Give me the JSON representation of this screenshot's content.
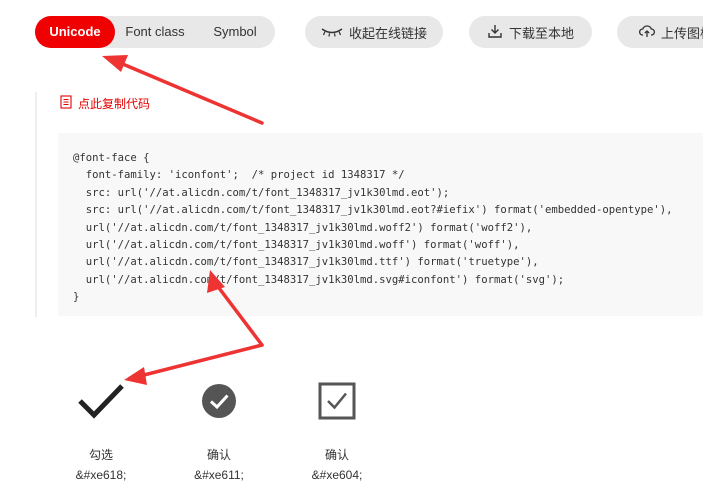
{
  "tabs": [
    "Unicode",
    "Font class",
    "Symbol"
  ],
  "active_tab": "Unicode",
  "toolbar": {
    "collapse_label": "收起在线链接",
    "download_label": "下载至本地",
    "upload_label": "上传图标"
  },
  "copy_link": "点此复制代码",
  "code_lines": [
    "@font-face {",
    "  font-family: 'iconfont';  /* project id 1348317 */",
    "  src: url('//at.alicdn.com/t/font_1348317_jv1k30lmd.eot');",
    "  src: url('//at.alicdn.com/t/font_1348317_jv1k30lmd.eot?#iefix') format('embedded-opentype'),",
    "  url('//at.alicdn.com/t/font_1348317_jv1k30lmd.woff2') format('woff2'),",
    "  url('//at.alicdn.com/t/font_1348317_jv1k30lmd.woff') format('woff'),",
    "  url('//at.alicdn.com/t/font_1348317_jv1k30lmd.ttf') format('truetype'),",
    "  url('//at.alicdn.com/t/font_1348317_jv1k30lmd.svg#iconfont') format('svg');",
    "}"
  ],
  "icons": [
    {
      "name": "勾选",
      "code": "&#xe618;",
      "icon": "checkmark-icon"
    },
    {
      "name": "确认",
      "code": "&#xe611;",
      "icon": "check-circle-icon"
    },
    {
      "name": "确认",
      "code": "&#xe604;",
      "icon": "check-square-icon"
    }
  ],
  "colors": {
    "accent": "#f00000",
    "copy_link": "#e50000",
    "button_bg": "#e8e8e8",
    "code_bg": "#f8f8f8",
    "annotation_arrow": "#ee3333"
  }
}
